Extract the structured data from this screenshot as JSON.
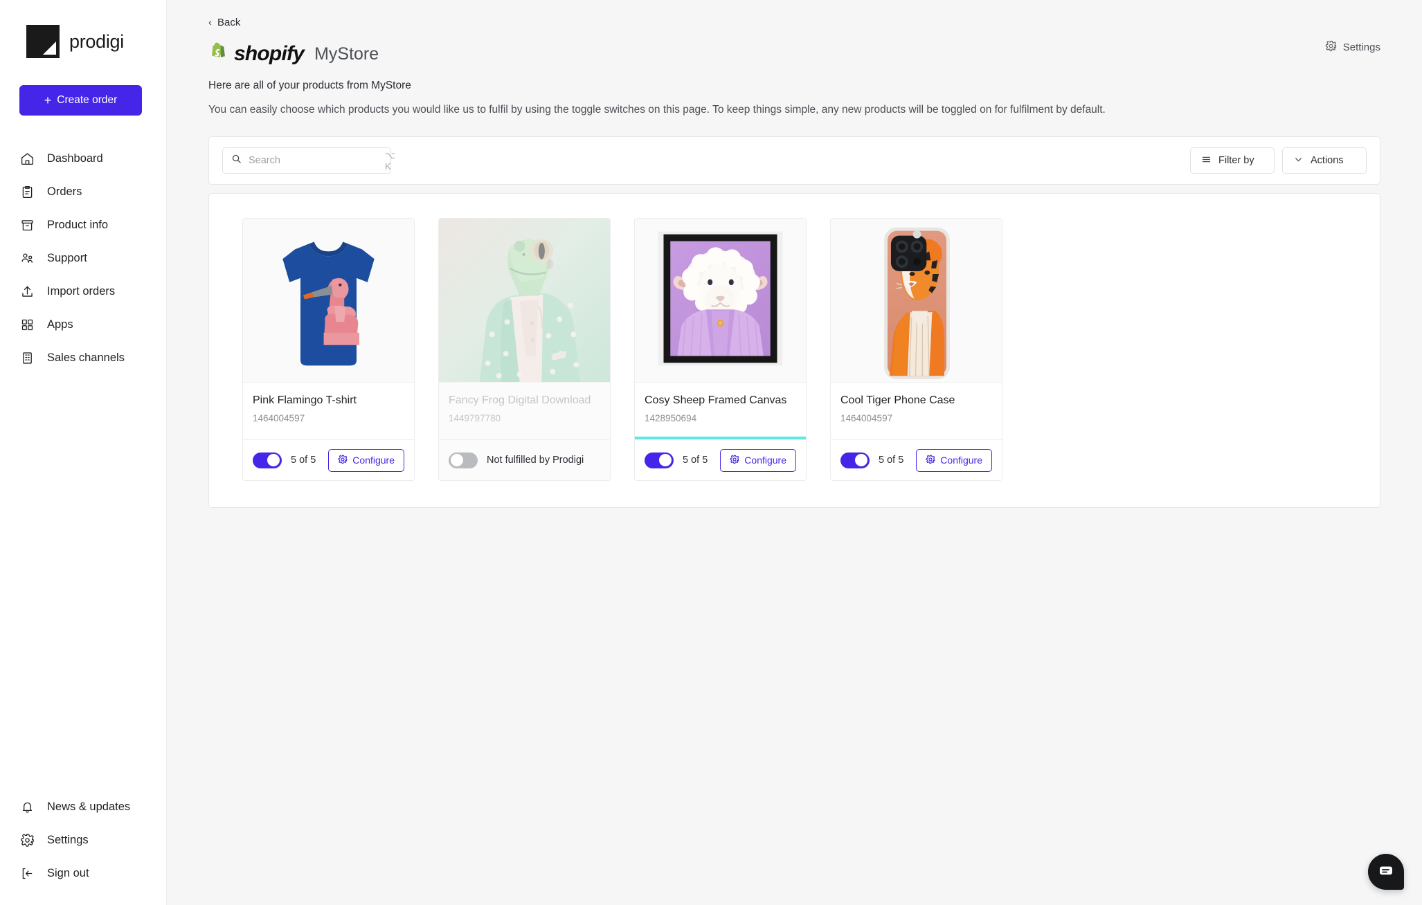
{
  "brand": {
    "name": "prodigi"
  },
  "sidebar": {
    "create_order_label": "Create order",
    "items": [
      {
        "label": "Dashboard",
        "icon": "home-icon"
      },
      {
        "label": "Orders",
        "icon": "clipboard-icon"
      },
      {
        "label": "Product info",
        "icon": "archive-icon"
      },
      {
        "label": "Support",
        "icon": "users-icon"
      },
      {
        "label": "Import orders",
        "icon": "upload-icon"
      },
      {
        "label": "Apps",
        "icon": "grid-icon"
      },
      {
        "label": "Sales channels",
        "icon": "building-icon"
      }
    ],
    "bottom_items": [
      {
        "label": "News & updates",
        "icon": "bell-icon"
      },
      {
        "label": "Settings",
        "icon": "gear-icon"
      },
      {
        "label": "Sign out",
        "icon": "sign-out-icon"
      }
    ]
  },
  "header": {
    "back_label": "Back",
    "channel": "shopify",
    "store_name": "MyStore",
    "subtitle": "Here are all of your products from MyStore",
    "description": "You can easily choose which products you would like us to fulfil by using the toggle switches on this page. To keep things simple, any new products will be toggled on for fulfilment by default.",
    "settings_label": "Settings"
  },
  "toolbar": {
    "search_placeholder": "Search",
    "search_value": "",
    "search_shortcut": "⌥ K",
    "filter_label": "Filter by",
    "actions_label": "Actions"
  },
  "products": [
    {
      "title": "Pink Flamingo T-shirt",
      "sku": "1464004597",
      "enabled": true,
      "status_label": "5 of 5",
      "action_label": "Configure",
      "highlighted": false
    },
    {
      "title": "Fancy Frog Digital Download",
      "sku": "1449797780",
      "enabled": false,
      "status_label": "Not fulfilled by Prodigi",
      "action_label": "",
      "highlighted": false
    },
    {
      "title": "Cosy Sheep Framed Canvas",
      "sku": "1428950694",
      "enabled": true,
      "status_label": "5 of 5",
      "action_label": "Configure",
      "highlighted": true
    },
    {
      "title": "Cool Tiger Phone Case",
      "sku": "1464004597",
      "enabled": true,
      "status_label": "5 of 5",
      "action_label": "Configure",
      "highlighted": false
    }
  ],
  "colors": {
    "accent": "#4525e8",
    "highlight": "#5fe7e2",
    "shopify_green": "#5e8e3e",
    "toggle_off": "#b9bbbe"
  }
}
